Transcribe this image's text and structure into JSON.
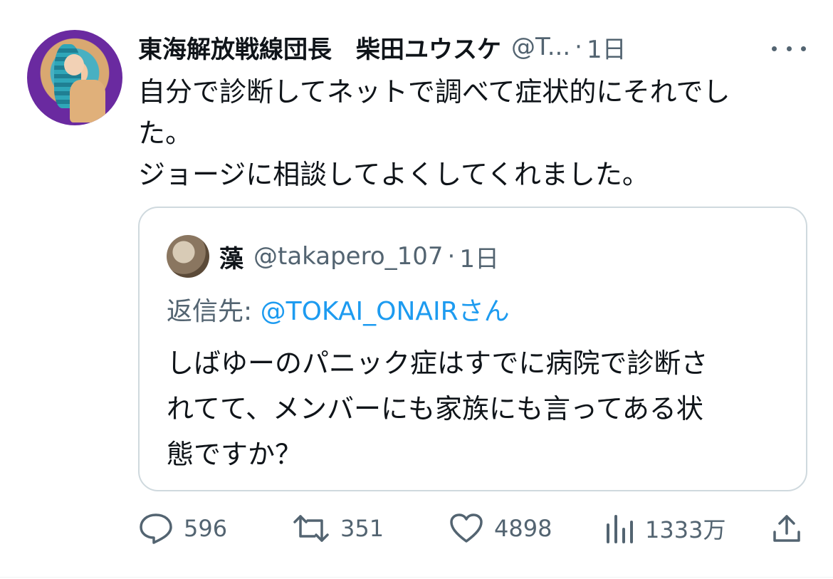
{
  "tweet": {
    "author_name": "東海解放戦線団長　柴田ユウスケ",
    "author_handle": "@T...",
    "separator": "·",
    "time": "1日",
    "text_lines": [
      "自分で診断してネットで調べて症状的にそれでし",
      "た。",
      "ジョージに相談してよくしてくれました。"
    ]
  },
  "quote": {
    "author_name": "藻",
    "author_handle": "@takapero_107",
    "separator": "·",
    "time": "1日",
    "reply_prefix": "返信先: ",
    "reply_mention": "@TOKAI_ONAIR",
    "reply_suffix": "さん",
    "text_lines": [
      "しばゆーのパニック症はすでに病院で診断さ",
      "れてて、メンバーにも家族にも言ってある状",
      "態ですか？"
    ]
  },
  "actions": {
    "replies": "596",
    "retweets": "351",
    "likes": "4898",
    "views": "1333万"
  },
  "colors": {
    "primary_text": "#0f1419",
    "secondary_text": "#536471",
    "link": "#1d9bf0",
    "border": "#cfd9de"
  },
  "icons": [
    "more-icon",
    "reply-icon",
    "retweet-icon",
    "like-icon",
    "views-icon",
    "share-icon"
  ]
}
